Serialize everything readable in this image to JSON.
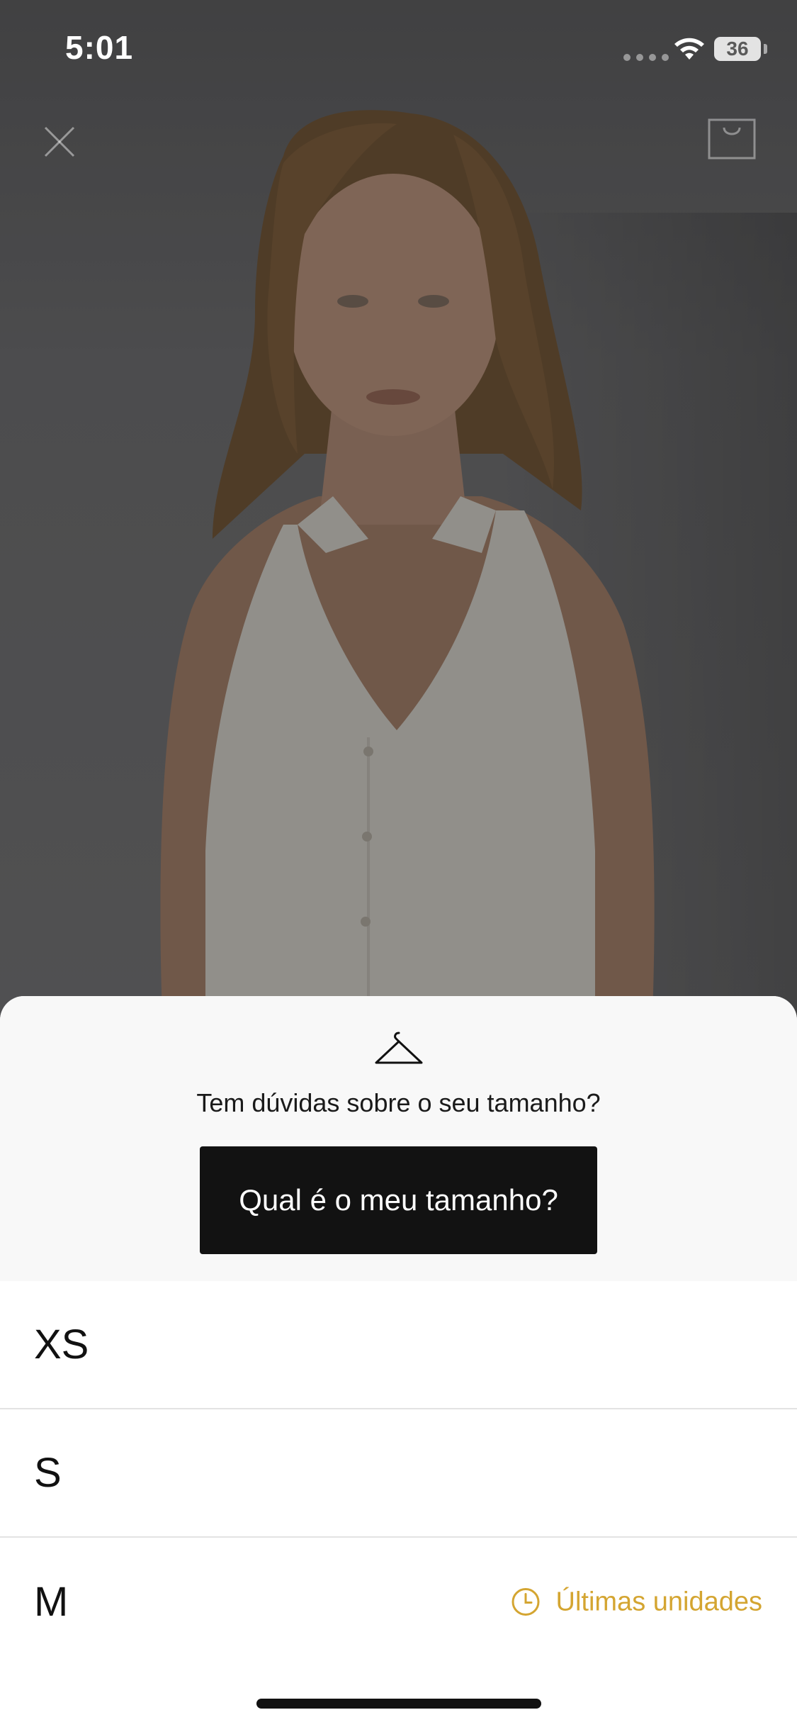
{
  "status_bar": {
    "time": "5:01",
    "battery": "36"
  },
  "header": {
    "close_icon": "close-icon",
    "bag_icon": "shopping-bag-icon"
  },
  "size_help": {
    "icon": "hanger-icon",
    "question": "Tem dúvidas sobre o seu tamanho?",
    "button_label": "Qual é o meu tamanho?"
  },
  "sizes": [
    {
      "label": "XS",
      "note": ""
    },
    {
      "label": "S",
      "note": ""
    },
    {
      "label": "M",
      "note": "Últimas unidades",
      "note_icon": "clock-icon"
    }
  ],
  "colors": {
    "accent_stock": "#d4a531",
    "button_bg": "#121212",
    "sheet_help_bg": "#f8f8f8"
  }
}
